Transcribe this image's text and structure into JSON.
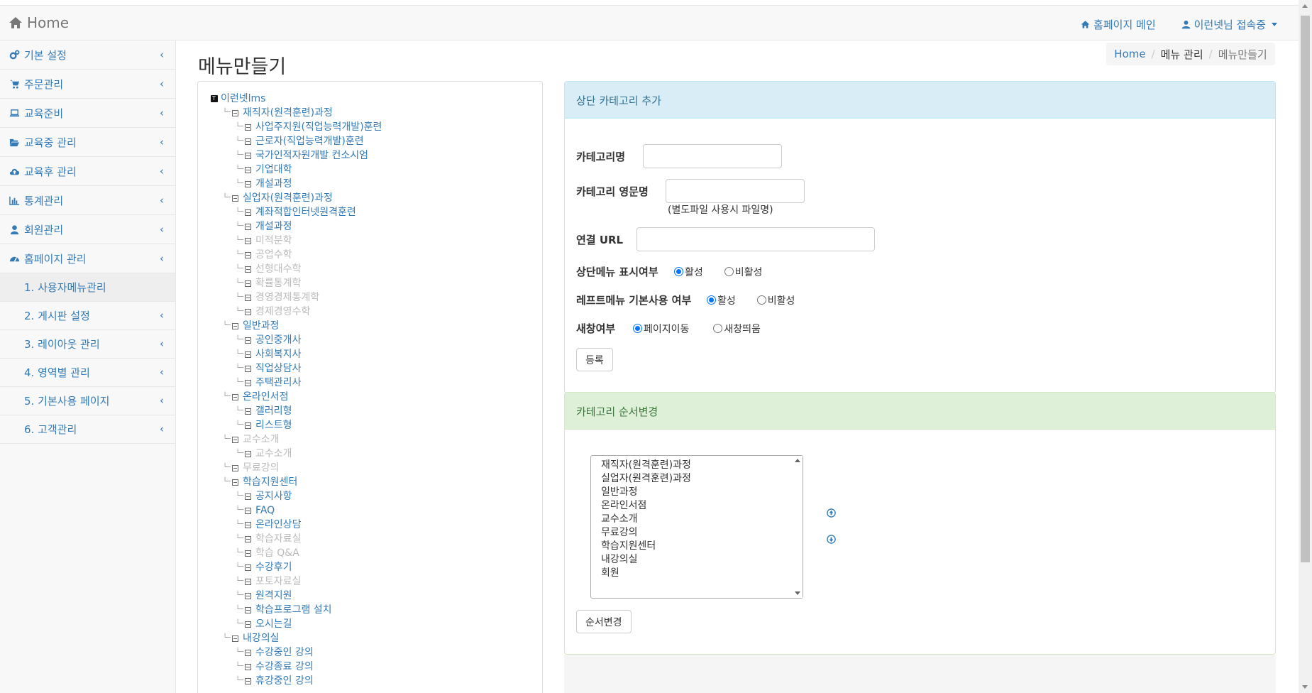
{
  "navbar": {
    "brand": "Home",
    "homepage_link": "홈페이지 메인",
    "user_link": "이런넷님 접속중"
  },
  "sidebar": {
    "items": [
      {
        "label": "기본 설정",
        "icon": "cogs-icon"
      },
      {
        "label": "주문관리",
        "icon": "cart-icon"
      },
      {
        "label": "교육준비",
        "icon": "laptop-icon"
      },
      {
        "label": "교육중 관리",
        "icon": "folder-open-icon"
      },
      {
        "label": "교육후 관리",
        "icon": "cloud-upload-icon"
      },
      {
        "label": "통계관리",
        "icon": "bar-chart-icon"
      },
      {
        "label": "회원관리",
        "icon": "user-icon"
      },
      {
        "label": "홈페이지 관리",
        "icon": "dashboard-icon"
      }
    ],
    "subitems": [
      {
        "label": "1. 사용자메뉴관리",
        "active": true
      },
      {
        "label": "2. 게시판 설정"
      },
      {
        "label": "3. 레이아웃 관리"
      },
      {
        "label": "4. 영역별 관리"
      },
      {
        "label": "5. 기본사용 페이지"
      },
      {
        "label": "6. 고객관리"
      }
    ]
  },
  "page_title": "메뉴만들기",
  "breadcrumb": {
    "home": "Home",
    "mid": "메뉴 관리",
    "current": "메뉴만들기"
  },
  "tree": {
    "root": "이런넷lms",
    "rows": [
      {
        "level": 1,
        "label": "재직자(원격훈련)과정"
      },
      {
        "level": 2,
        "label": "사업주지원(직업능력개발)훈련"
      },
      {
        "level": 2,
        "label": "근로자(직업능력개발)훈련"
      },
      {
        "level": 2,
        "label": "국가인적자원개발 컨소시엄"
      },
      {
        "level": 2,
        "label": "기업대학"
      },
      {
        "level": 2,
        "label": "개설과정"
      },
      {
        "level": 1,
        "label": "실업자(원격훈련)과정"
      },
      {
        "level": 2,
        "label": "계좌적합인터넷원격훈련"
      },
      {
        "level": 2,
        "label": "개설과정"
      },
      {
        "level": 2,
        "label": "미적분학",
        "disabled": true
      },
      {
        "level": 2,
        "label": "공업수학",
        "disabled": true
      },
      {
        "level": 2,
        "label": "선형대수학",
        "disabled": true
      },
      {
        "level": 2,
        "label": "확률통계학",
        "disabled": true
      },
      {
        "level": 2,
        "label": "경영경제통계학",
        "disabled": true
      },
      {
        "level": 2,
        "label": "경제경영수학",
        "disabled": true
      },
      {
        "level": 1,
        "label": "일반과정"
      },
      {
        "level": 2,
        "label": "공인중개사"
      },
      {
        "level": 2,
        "label": "사회복지사"
      },
      {
        "level": 2,
        "label": "직업상담사"
      },
      {
        "level": 2,
        "label": "주택관리사"
      },
      {
        "level": 1,
        "label": "온라인서점"
      },
      {
        "level": 2,
        "label": "갤러리형"
      },
      {
        "level": 2,
        "label": "리스트형"
      },
      {
        "level": 1,
        "label": "교수소개",
        "disabled": true
      },
      {
        "level": 2,
        "label": "교수소개",
        "disabled": true
      },
      {
        "level": 1,
        "label": "무료강의",
        "disabled": true
      },
      {
        "level": 1,
        "label": "학습지원센터"
      },
      {
        "level": 2,
        "label": "공지사항"
      },
      {
        "level": 2,
        "label": "FAQ"
      },
      {
        "level": 2,
        "label": "온라인상담"
      },
      {
        "level": 2,
        "label": "학습자료실",
        "disabled": true
      },
      {
        "level": 2,
        "label": "학습 Q&A",
        "disabled": true
      },
      {
        "level": 2,
        "label": "수강후기"
      },
      {
        "level": 2,
        "label": "포토자료실",
        "disabled": true
      },
      {
        "level": 2,
        "label": "원격지원"
      },
      {
        "level": 2,
        "label": "학습프로그램 설치"
      },
      {
        "level": 2,
        "label": "오시는길"
      },
      {
        "level": 1,
        "label": "내강의실"
      },
      {
        "level": 2,
        "label": "수강중인 강의"
      },
      {
        "level": 2,
        "label": "수강종료 강의"
      },
      {
        "level": 2,
        "label": "휴강중인 강의"
      }
    ]
  },
  "add_panel": {
    "heading": "상단 카테고리 추가",
    "category_name_label": "카테고리명",
    "category_name_value": "",
    "category_en_label": "카테고리 영문명",
    "category_en_value": "",
    "category_en_note": "(별도파일 사용시 파일명)",
    "url_label": "연결 URL",
    "url_value": "",
    "top_menu_label": "상단메뉴 표시여부",
    "top_menu_on": "활성",
    "top_menu_off": "비활성",
    "left_menu_label": "레프트메뉴 기본사용 여부",
    "left_menu_on": "활성",
    "left_menu_off": "비활성",
    "new_window_label": "새창여부",
    "new_window_page": "페이지이동",
    "new_window_popup": "새창띄움",
    "submit_label": "등록"
  },
  "order_panel": {
    "heading": "카테고리 순서변경",
    "options": [
      "재직자(원격훈련)과정",
      "실업자(원격훈련)과정",
      "일반과정",
      "온라인서점",
      "교수소개",
      "무료강의",
      "학습지원센터",
      "내강의실",
      "회원"
    ],
    "submit_label": "순서변경"
  }
}
